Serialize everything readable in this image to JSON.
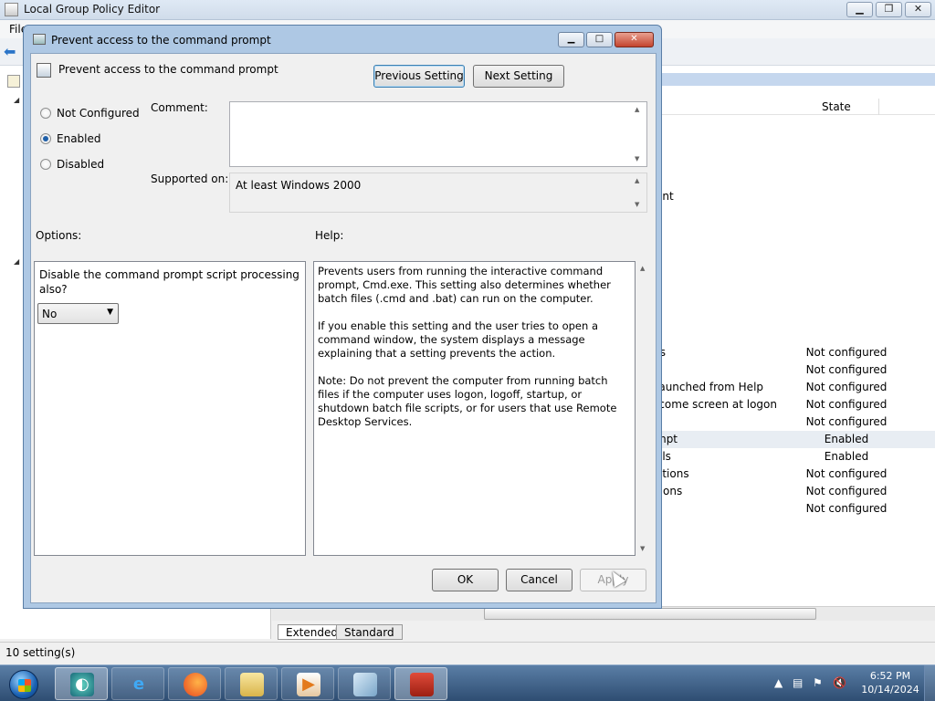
{
  "main_window": {
    "title": "Local Group Policy Editor",
    "menu_first": "File",
    "list_header_state": "State",
    "rows": [
      {
        "name": "ent",
        "state": ""
      },
      {
        "name": "ts",
        "state": "Not configured"
      },
      {
        "name": "",
        "state": "Not configured"
      },
      {
        "name": "launched from Help",
        "state": "Not configured"
      },
      {
        "name": "lcome screen at logon",
        "state": "Not configured"
      },
      {
        "name": "",
        "state": "Not configured"
      },
      {
        "name": "mpt",
        "state": "Enabled"
      },
      {
        "name": "ols",
        "state": "Enabled"
      },
      {
        "name": "ations",
        "state": "Not configured"
      },
      {
        "name": "tions",
        "state": "Not configured"
      },
      {
        "name": "",
        "state": "Not configured"
      }
    ],
    "tabs": [
      "Extended",
      "Standard"
    ],
    "status": "10 setting(s)"
  },
  "dialog": {
    "window_title": "Prevent access to the command prompt",
    "header_title": "Prevent access to the command prompt",
    "prev_button": "Previous Setting",
    "next_button": "Next Setting",
    "radios": [
      {
        "label": "Not Configured",
        "checked": false
      },
      {
        "label": "Enabled",
        "checked": true
      },
      {
        "label": "Disabled",
        "checked": false
      }
    ],
    "comment_label": "Comment:",
    "comment_value": "",
    "supported_label": "Supported on:",
    "supported_value": "At least Windows 2000",
    "options_label": "Options:",
    "help_label": "Help:",
    "option_text": "Disable the command prompt script processing also?",
    "option_select_value": "No",
    "help_paragraphs": [
      "Prevents users from running the interactive command prompt, Cmd.exe. This setting also determines whether batch files (.cmd and .bat) can run on the computer.",
      "If you enable this setting and the user tries to open a command window, the system displays a message explaining that a setting prevents the action.",
      "Note: Do not prevent the computer from running batch files if the computer uses logon, logoff, startup, or shutdown batch file scripts, or for users that use Remote Desktop Services."
    ],
    "ok_button": "OK",
    "cancel_button": "Cancel",
    "apply_button": "Apply"
  },
  "taskbar": {
    "clock_time": "6:52 PM",
    "clock_date": "10/14/2024"
  }
}
